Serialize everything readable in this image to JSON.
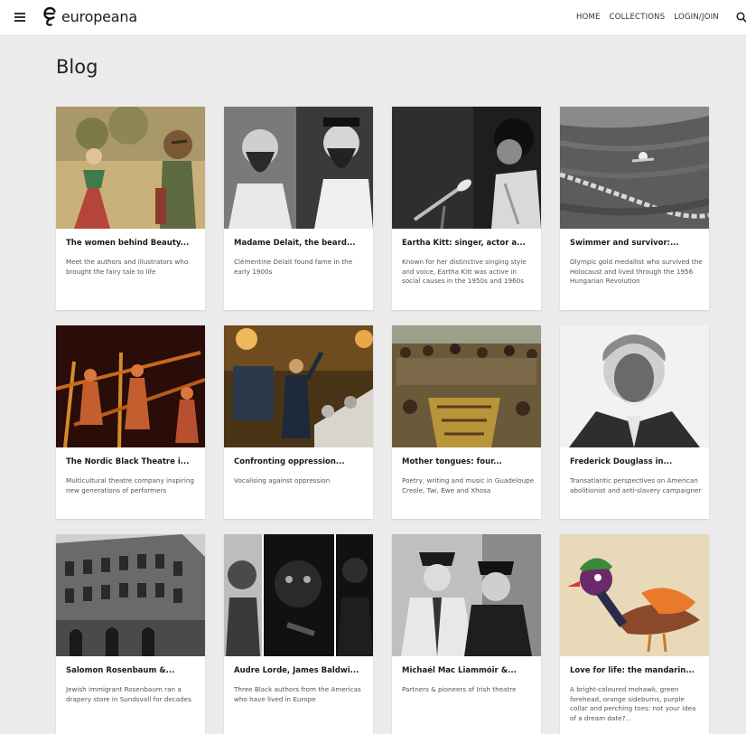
{
  "header": {
    "logo_text": "europeana",
    "nav": [
      "HOME",
      "COLLECTIONS",
      "LOGIN/JOIN"
    ]
  },
  "page": {
    "title": "Blog"
  },
  "cards": [
    {
      "title": "The women behind Beauty...",
      "desc": "Meet the authors and illustrators who brought the fairy tale to life",
      "image": "illustration-icon"
    },
    {
      "title": "Madame Delait, the beard...",
      "desc": "Clémentine Delait found fame in the early 1900s",
      "image": "bearded-portrait-icon"
    },
    {
      "title": "Eartha Kitt: singer, actor a...",
      "desc": "Known for her distinctive singing style and voice, Eartha Kitt was active in social causes in the 1950s and 1960s",
      "image": "microphone-portrait-icon"
    },
    {
      "title": "Swimmer and survivor:...",
      "desc": "Olympic gold medallist who survived the Holocaust and lived through the 1956 Hungarian Revolution",
      "image": "swimming-pool-icon"
    },
    {
      "title": "The Nordic Black Theatre i...",
      "desc": "Multicultural theatre company inspiring new generations of performers",
      "image": "theatre-performers-icon"
    },
    {
      "title": "Confronting oppression...",
      "desc": "Vocalising against oppression",
      "image": "speaker-stage-icon"
    },
    {
      "title": "Mother tongues: four...",
      "desc": "Poetry, writing and music in Guadeloupe Creole, Twi, Ewe and Xhosa",
      "image": "crowd-gathering-icon"
    },
    {
      "title": "Frederick Douglass in...",
      "desc": "Transatlantic perspectives on American abolitionist and anti-slavery campaigner",
      "image": "engraved-portrait-icon"
    },
    {
      "title": "Salomon Rosenbaum &...",
      "desc": "Jewish immigrant Rosenbaum ran a drapery store in Sundsvall for decades",
      "image": "building-facade-icon"
    },
    {
      "title": "Audre Lorde, James Baldwi...",
      "desc": "Three Black authors from the Americas who have lived in Europe",
      "image": "three-portraits-icon"
    },
    {
      "title": "Michaél Mac Liammóir &...",
      "desc": "Partners & pioneers of Irish theatre",
      "image": "two-men-portrait-icon"
    },
    {
      "title": "Love for life: the mandarin...",
      "desc": "A bright-coloured mohawk, green forehead, orange sideburns, purple collar and perching toes: not your idea of a dream date?...",
      "image": "mandarin-duck-icon"
    }
  ]
}
